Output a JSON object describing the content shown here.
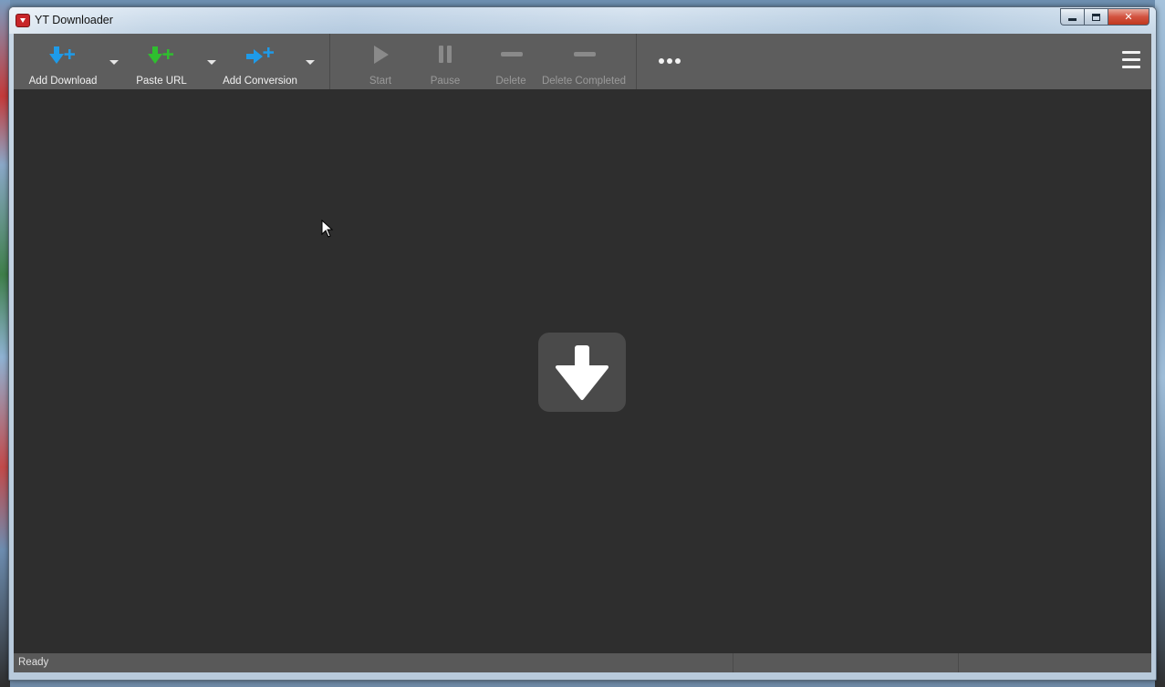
{
  "window": {
    "title": "YT Downloader"
  },
  "toolbar": {
    "add_download": "Add Download",
    "paste_url": "Paste URL",
    "add_conversion": "Add Conversion",
    "start": "Start",
    "pause": "Pause",
    "delete": "Delete",
    "delete_completed": "Delete Completed"
  },
  "colors": {
    "accent_blue": "#1e9be9",
    "accent_green": "#2fbf2f",
    "toolbar_bg": "#5d5d5d",
    "content_bg": "#2e2e2e"
  },
  "status": {
    "text": "Ready"
  }
}
